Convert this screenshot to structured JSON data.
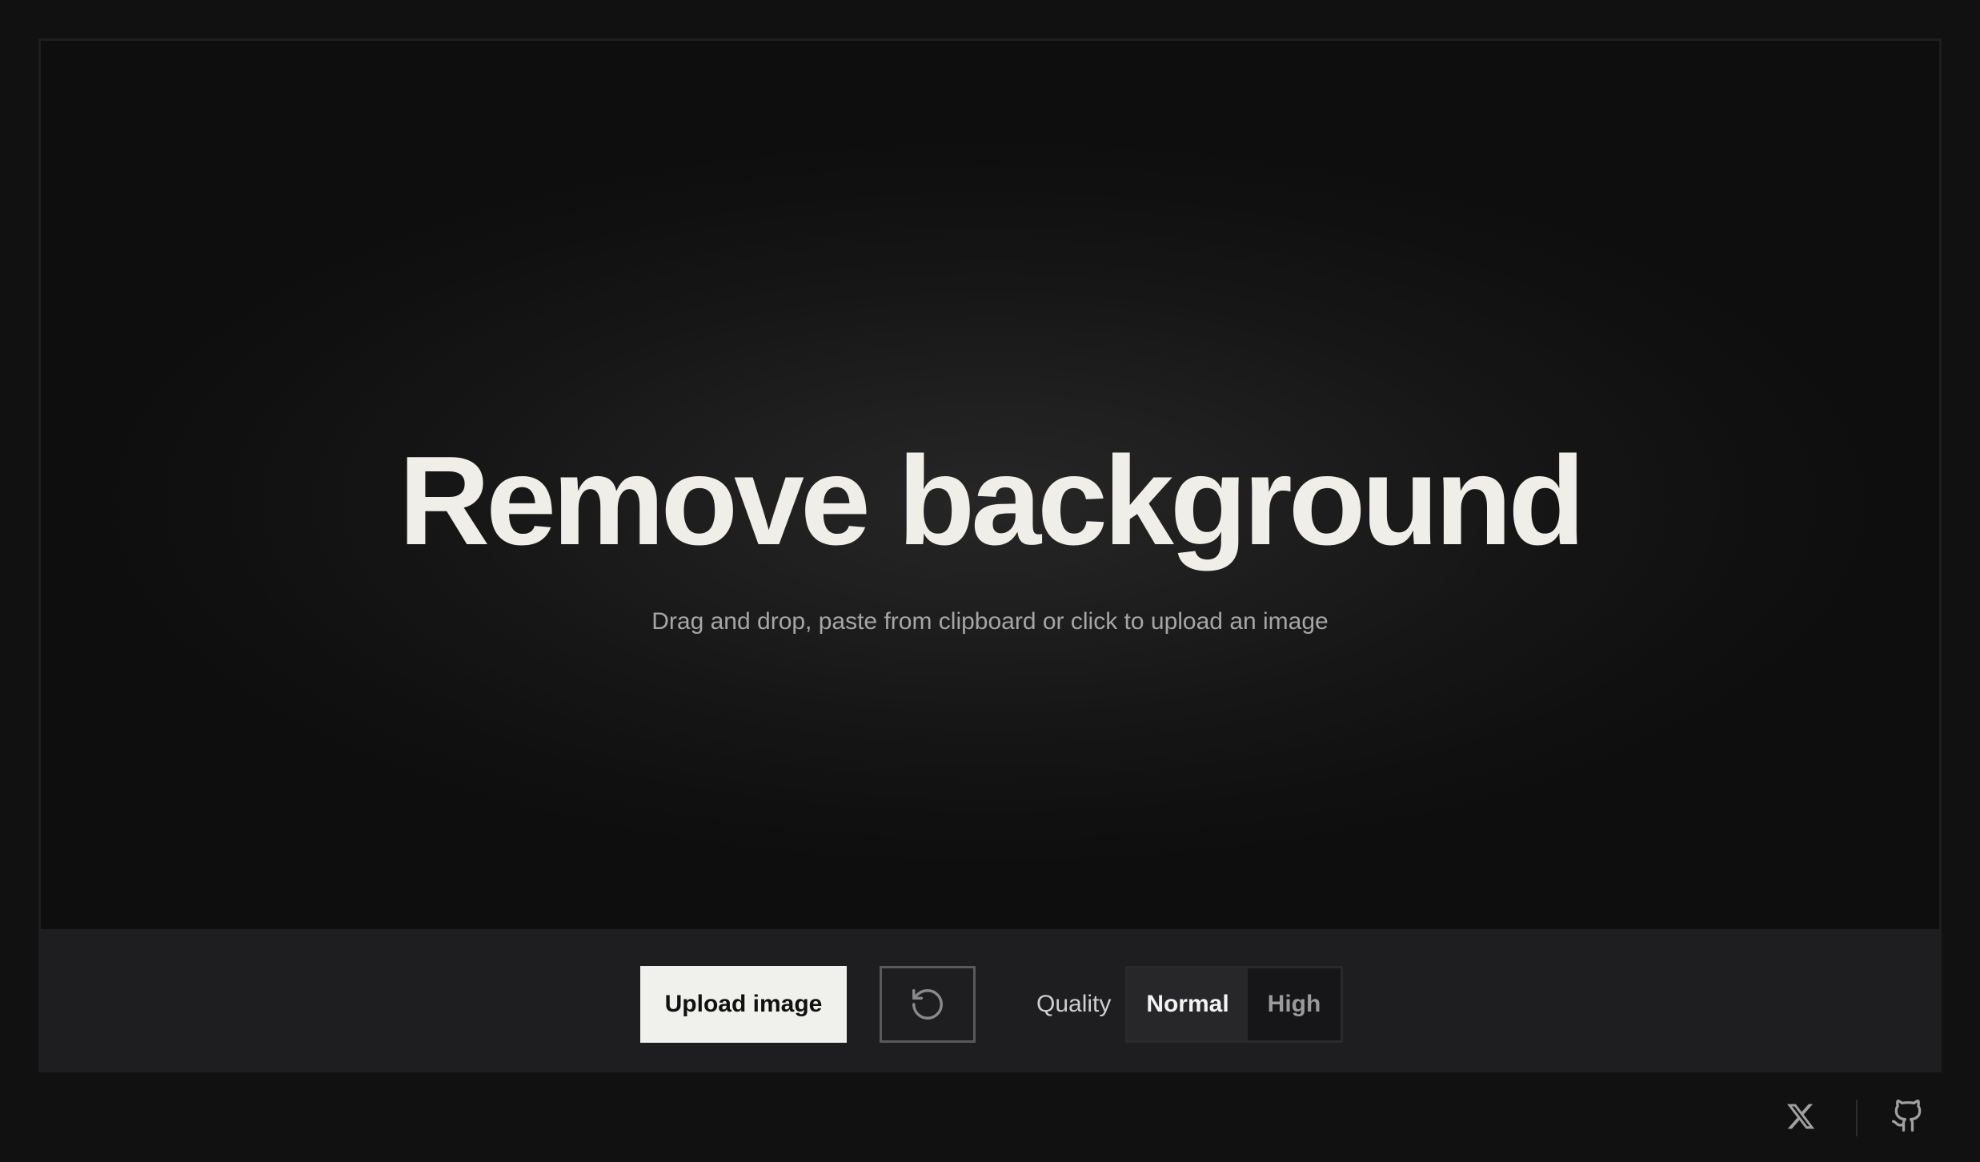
{
  "hero": {
    "title": "Remove background",
    "subtitle": "Drag and drop, paste from clipboard or click to upload an image"
  },
  "toolbar": {
    "upload_label": "Upload image",
    "reset_icon": "rotate-ccw-icon",
    "quality_label": "Quality",
    "quality_options": [
      "Normal",
      "High"
    ],
    "quality_selected": "Normal"
  },
  "footer": {
    "links": [
      {
        "icon": "x-twitter-icon"
      },
      {
        "icon": "github-icon"
      }
    ]
  },
  "colors": {
    "background": "#111111",
    "toolbar": "#1e1e20",
    "title": "#efeee9",
    "subtitle": "#a6a6a6",
    "primary_button": "#f0f0ec"
  }
}
